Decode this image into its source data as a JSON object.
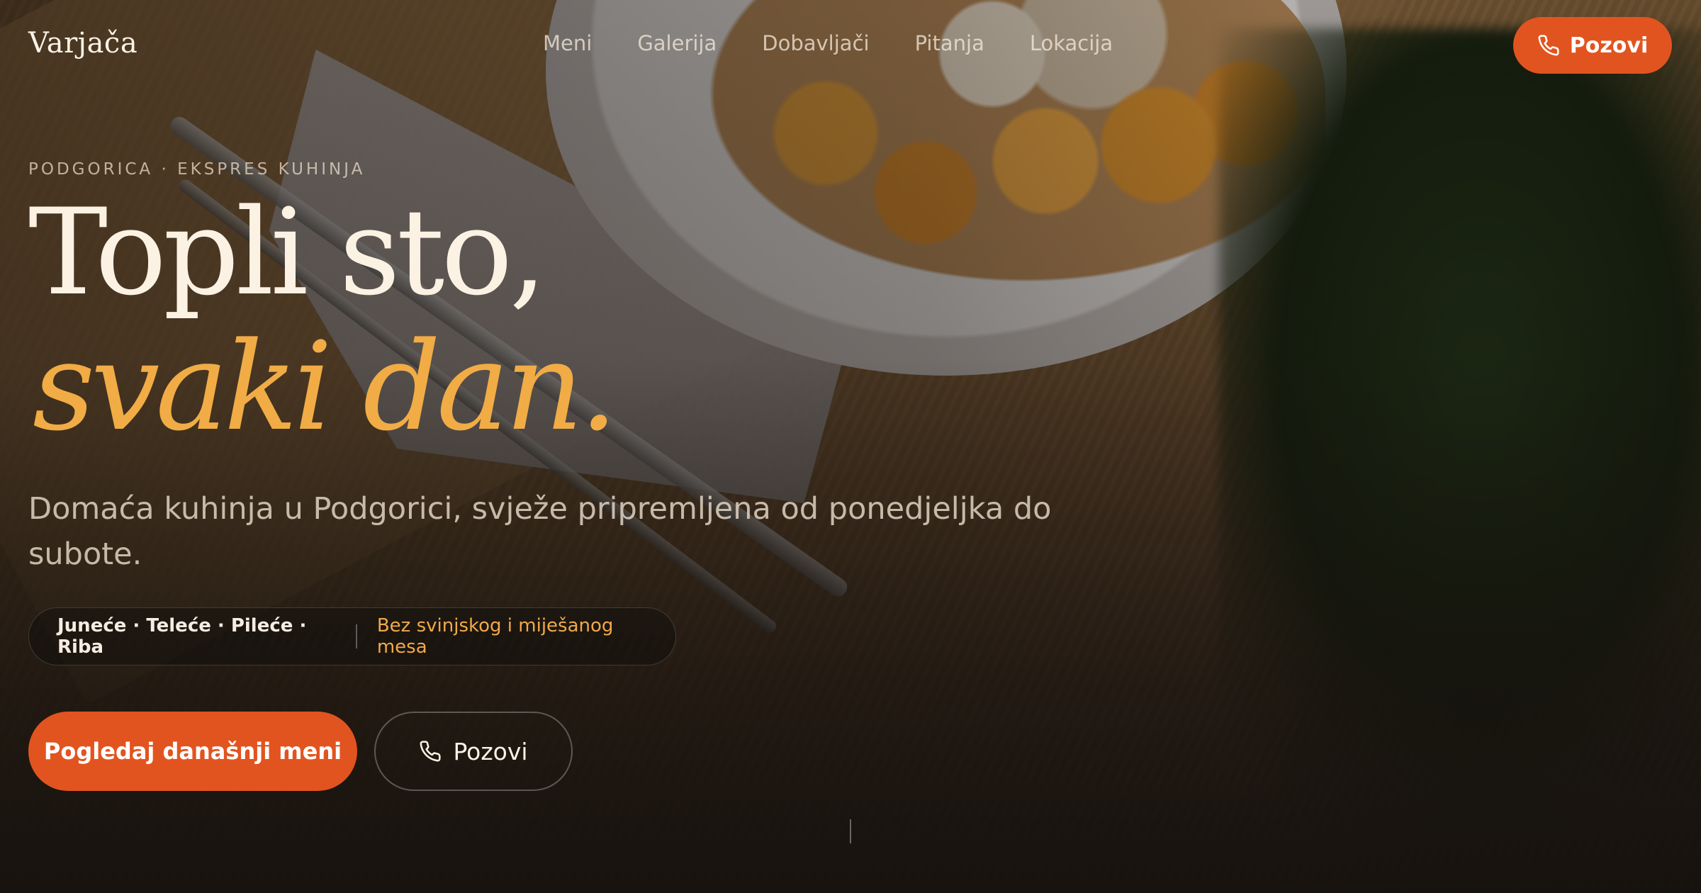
{
  "brand": {
    "logo_text": "Varjača"
  },
  "nav": {
    "items": [
      "Meni",
      "Galerija",
      "Dobavljači",
      "Pitanja",
      "Lokacija"
    ]
  },
  "header": {
    "call_label": "Pozovi"
  },
  "hero": {
    "eyebrow": "PODGORICA · EKSPRES KUHINJA",
    "title_line1": "Topli sto,",
    "title_line2": "svaki dan.",
    "lead": "Domaća kuhinja u Podgorici, svježe pripremljena od ponedjeljka do subote.",
    "meats": "Juneće · Teleće · Pileće · Riba",
    "meats_note": "Bez svinjskog i miješanog mesa",
    "primary_cta": "Pogledaj današnji meni",
    "secondary_cta": "Pozovi"
  },
  "colors": {
    "accent": "#e2541f",
    "highlight": "#f1ac46"
  },
  "icons": {
    "call": "phone-icon"
  }
}
